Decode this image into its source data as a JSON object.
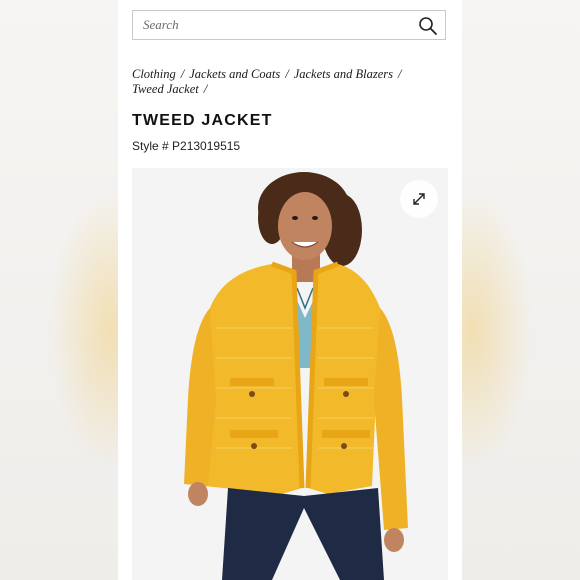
{
  "search": {
    "placeholder": "Search",
    "icon": "search-icon"
  },
  "breadcrumb": {
    "items": [
      "Clothing",
      "Jackets and Coats",
      "Jackets and Blazers",
      "Tweed Jacket"
    ],
    "separator": "/"
  },
  "product": {
    "title": "TWEED JACKET",
    "style_number": "Style # P213019515",
    "image_alt": "Model wearing yellow tweed jacket",
    "expand_icon": "expand-icon"
  },
  "colors": {
    "accent_jacket": "#f2b92a",
    "text": "#111111",
    "border": "#c9c9c9"
  }
}
